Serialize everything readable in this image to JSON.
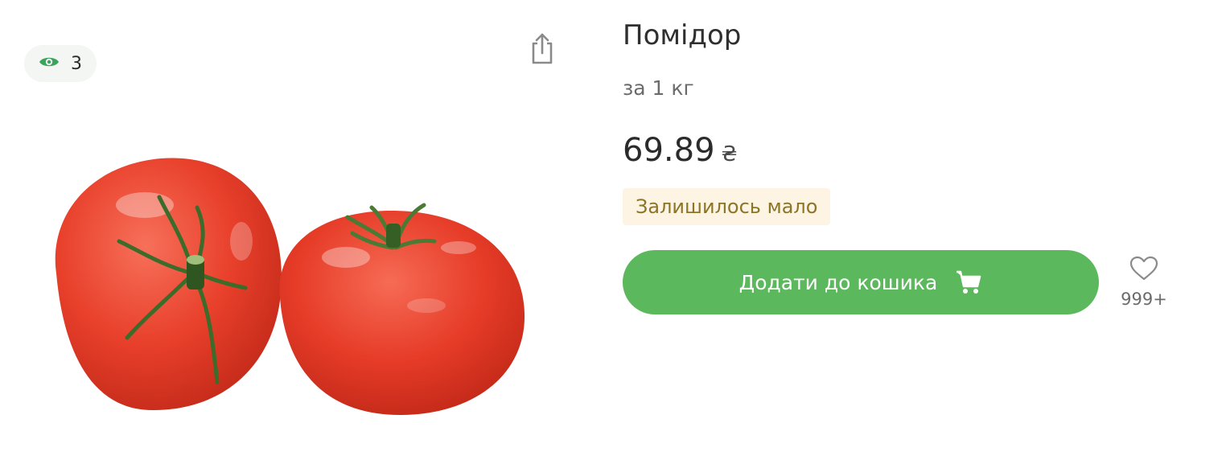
{
  "views": {
    "count": "3",
    "icon": "eye-icon",
    "color": "#3aa35c"
  },
  "share": {
    "icon": "share-icon"
  },
  "product": {
    "title": "Помідор",
    "unit": "за 1 кг",
    "price": "69.89",
    "currency": "₴",
    "stock_status": "Залишилось мало",
    "add_to_cart_label": "Додати до кошика",
    "favorites_count": "999+"
  },
  "colors": {
    "accent_green": "#5cb85c",
    "stock_badge_bg": "#fdf4e3",
    "stock_badge_text": "#8c7526"
  }
}
